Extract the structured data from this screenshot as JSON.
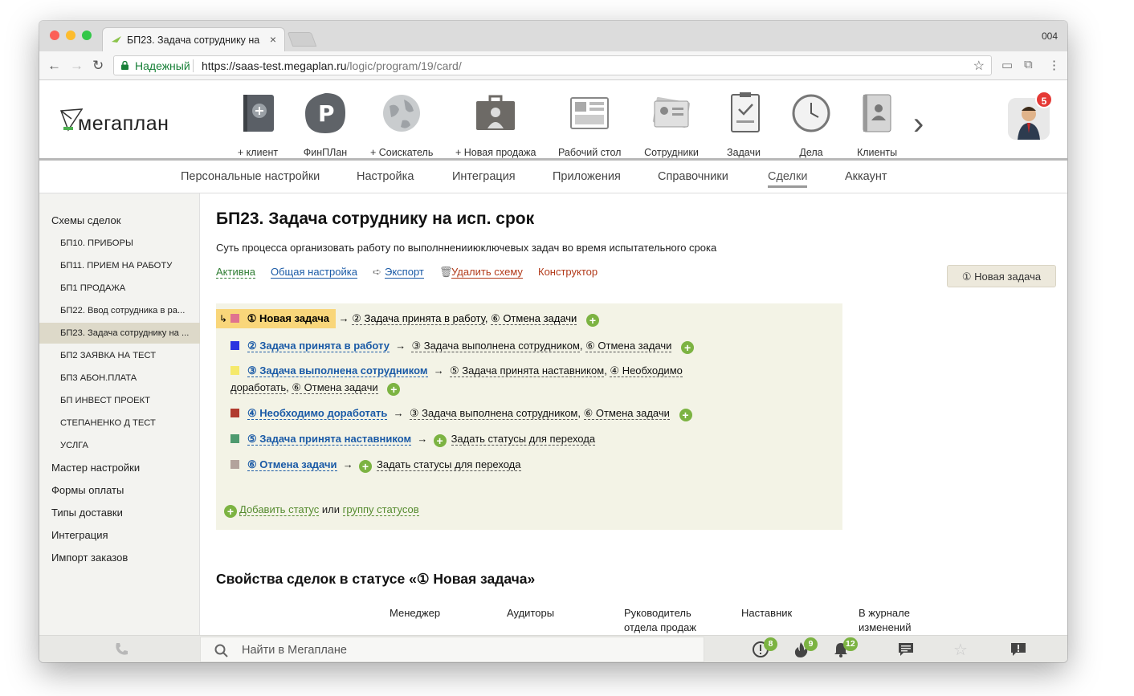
{
  "browser": {
    "tab_title": "БП23. Задача сотруднику на",
    "profile_label": "004",
    "secure_label": "Надежный",
    "url_host": "https://saas-test.megaplan.ru",
    "url_path": "/logic/program/19/card/"
  },
  "app": {
    "logo_text": "мегаплан",
    "nav": [
      {
        "label": "+ клиент",
        "icon": "add-client-icon"
      },
      {
        "label": "ФинПЛан",
        "icon": "finplan-icon"
      },
      {
        "label": "+ Соискатель",
        "icon": "globe-icon"
      },
      {
        "label": "+ Новая продажа",
        "icon": "briefcase-icon"
      },
      {
        "label": "Рабочий стол",
        "icon": "dashboard-icon"
      },
      {
        "label": "Сотрудники",
        "icon": "id-card-icon"
      },
      {
        "label": "Задачи",
        "icon": "clipboard-icon"
      },
      {
        "label": "Дела",
        "icon": "clock-icon"
      },
      {
        "label": "Клиенты",
        "icon": "contacts-book-icon"
      }
    ],
    "avatar_badge": "5"
  },
  "subnav": [
    "Персональные настройки",
    "Настройка",
    "Интеграция",
    "Приложения",
    "Справочники",
    "Сделки",
    "Аккаунт"
  ],
  "sidebar": {
    "schemes_title": "Схемы сделок",
    "schemes": [
      "БП10. ПРИБОРЫ",
      "БП11. ПРИЕМ НА РАБОТУ",
      "БП1 ПРОДАЖА",
      "БП22. Ввод сотрудника в ра...",
      "БП23. Задача сотруднику на ...",
      "БП2 ЗАЯВКА НА ТЕСТ",
      "БП3 АБОН.ПЛАТА",
      "БП ИНВЕСТ ПРОЕКТ",
      "СТЕПАНЕНКО Д ТЕСТ",
      "УСЛГА"
    ],
    "sections": [
      "Мастер настройки",
      "Формы оплаты",
      "Типы доставки",
      "Интеграция",
      "Импорт заказов"
    ]
  },
  "main": {
    "title": "БП23. Задача сотруднику на исп. срок",
    "description": "Суть процесса организовать работу по выполнненииюключевых задач во время испытательного срока",
    "actions": {
      "active": "Активна",
      "general": "Общая настройка",
      "export": "Экспорт",
      "delete": "Удалить схему",
      "constructor": "Конструктор"
    },
    "new_task_button": "① Новая задача",
    "statuses": [
      {
        "name": "① Новая задача",
        "color": "#e0738f",
        "transitions": [
          "② Задача принята в работу",
          "⑥ Отмена задачи"
        ]
      },
      {
        "name": "② Задача принята в работу",
        "color": "#2b35e0",
        "transitions": [
          "③ Задача выполнена сотрудником",
          "⑥ Отмена задачи"
        ]
      },
      {
        "name": "③ Задача выполнена сотрудником",
        "color": "#f5e96b",
        "transitions": [
          "⑤ Задача принята наставником",
          "④ Необходимо доработать",
          "⑥ Отмена задачи"
        ]
      },
      {
        "name": "④ Необходимо доработать",
        "color": "#b03a2e",
        "transitions": [
          "③ Задача выполнена сотрудником",
          "⑥ Отмена задачи"
        ]
      },
      {
        "name": "⑤ Задача принята наставником",
        "color": "#4e9a6f",
        "transitions": [
          "Задать статусы для перехода"
        ]
      },
      {
        "name": "⑥ Отмена задачи",
        "color": "#b3a39c",
        "transitions": [
          "Задать статусы для перехода"
        ]
      }
    ],
    "add_status": {
      "link1": "Добавить статус",
      "or": "или",
      "link2": "группу статусов"
    },
    "properties_title": "Свойства сделок в статусе «① Новая задача»",
    "columns": [
      "Менеджер",
      "Аудиторы",
      "Руководитель отдела продаж",
      "Наставник",
      "В журнале изменений"
    ]
  },
  "bottombar": {
    "search_placeholder": "Найти в Мегаплане",
    "badges": {
      "alerts": "8",
      "fire": "9",
      "bell": "12"
    }
  }
}
